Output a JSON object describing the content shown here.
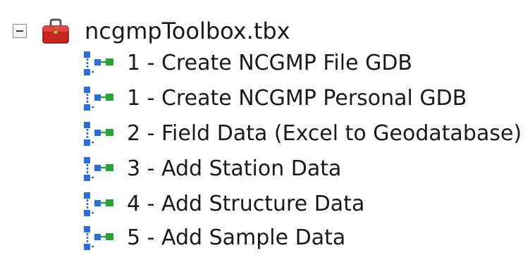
{
  "toolbox": {
    "expander_icon": "minus-expander-icon",
    "icon": "red-toolbox-icon",
    "label": "ncgmpToolbox.tbx"
  },
  "tools": [
    {
      "icon": "script-tool-icon",
      "label": "1 - Create NCGMP File GDB"
    },
    {
      "icon": "script-tool-icon",
      "label": "1 - Create NCGMP Personal GDB"
    },
    {
      "icon": "script-tool-icon",
      "label": "2 - Field Data (Excel to Geodatabase)"
    },
    {
      "icon": "script-tool-icon",
      "label": "3 - Add Station Data"
    },
    {
      "icon": "script-tool-icon",
      "label": "4 - Add Structure Data"
    },
    {
      "icon": "script-tool-icon",
      "label": "5 - Add Sample Data"
    }
  ],
  "colors": {
    "toolbox_red": "#c8251e",
    "tool_blue": "#2b6fd6",
    "tool_green": "#2aa43a"
  }
}
